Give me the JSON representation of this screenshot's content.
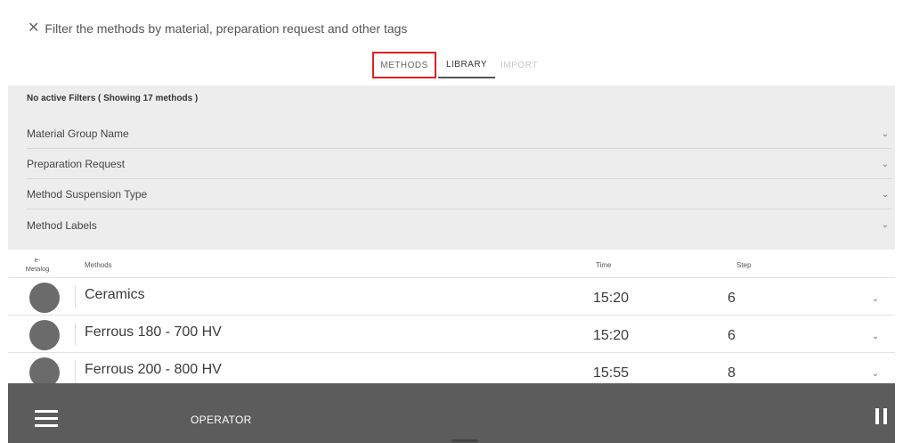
{
  "header": {
    "filter_text": "Filter the methods by material, preparation request and other tags"
  },
  "tabs": [
    {
      "label": "METHODS"
    },
    {
      "label": "LIBRARY"
    },
    {
      "label": "IMPORT"
    }
  ],
  "filters": {
    "status": "No active Filters ( Showing 17 methods )",
    "groups": [
      {
        "label": "Material Group Name"
      },
      {
        "label": "Preparation Request"
      },
      {
        "label": "Method Suspension Type"
      },
      {
        "label": "Method Labels"
      }
    ]
  },
  "table": {
    "columns": {
      "emetalog": "e-\nMetalog",
      "methods": "Methods",
      "time": "Time",
      "step": "Step"
    },
    "rows": [
      {
        "name": "Ceramics",
        "time": "15:20",
        "step": "6"
      },
      {
        "name": "Ferrous 180 - 700 HV",
        "time": "15:20",
        "step": "6"
      },
      {
        "name": "Ferrous 200 - 800 HV",
        "time": "15:55",
        "step": "8"
      }
    ]
  },
  "bottom_bar": {
    "role_label": "OPERATOR"
  },
  "colors": {
    "highlight": "#e02020",
    "bar": "#5c5c5c",
    "panel": "#ededed",
    "avatar": "#6b6b6b"
  }
}
